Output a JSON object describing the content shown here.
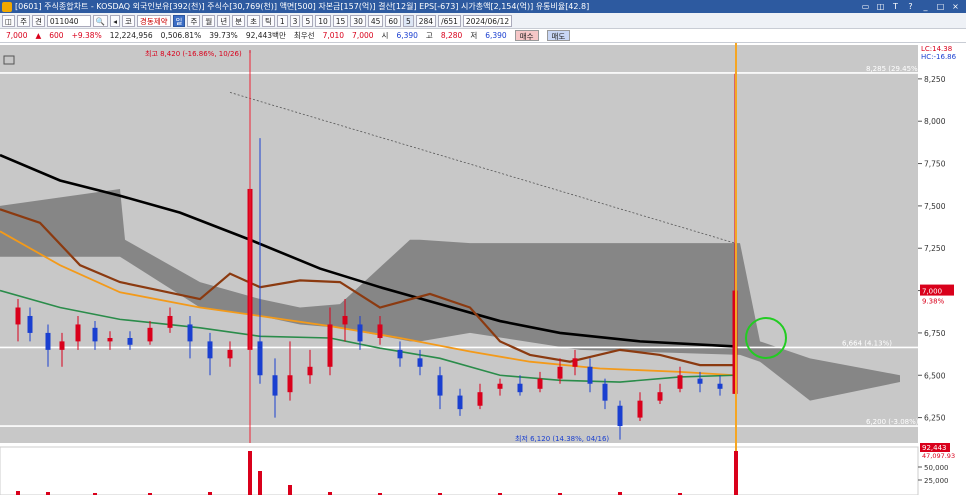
{
  "window": {
    "title": "[0601] 주식종합차트 - KOSDAQ 외국인보유[392(천)] 주식수[30,769(천)] 액면[500] 자본금[157(억)] 결산[12월] EPS[-673] 시가총액[2,154(억)] 유통비율[42.8]",
    "buttons": [
      "▭",
      "◫",
      "T",
      "?",
      "_",
      "□",
      "×"
    ]
  },
  "toolbar": {
    "items_left": [
      "◫",
      "주",
      "견",
      "조"
    ],
    "stock_code": "011040",
    "search_icon": "🔍",
    "arrow": "◂",
    "prefix": "코",
    "stock_name": "경동제약",
    "period_buttons": [
      "일",
      "주",
      "월",
      "년",
      "분",
      "초",
      "틱"
    ],
    "period_selected": "일",
    "interval_buttons": [
      "1",
      "3",
      "5",
      "10",
      "15",
      "30",
      "45",
      "60",
      "5"
    ],
    "count": "284",
    "total": "/651",
    "date": "2024/06/12"
  },
  "pricebar": {
    "price": "7,000",
    "arrow": "▲",
    "change": "600",
    "change_pct": "+9.38%",
    "volume": "12,224,956",
    "vol_pct": "0,506.81%",
    "turnover": "39.73%",
    "trade_amount": "92,443백만",
    "label_best": "최우선",
    "best": "7,010",
    "best2": "7,000",
    "open_label": "시",
    "open": "6,390",
    "high_label": "고",
    "high": "8,280",
    "low_label": "저",
    "low": "6,390",
    "buy_label": "매수",
    "sell_label": "매도"
  },
  "colors": {
    "bg": "#c8c8c8",
    "up": "#d9001b",
    "down": "#1a3fd0",
    "ichimoku": "#7a7a7a",
    "ma_long": "#000000",
    "ma_brown": "#8b3a10",
    "ma_orange": "#f39a1a",
    "ma_green": "#2a8c4a",
    "current_line": "#f5a623",
    "circle": "#22cc22"
  },
  "annotations": {
    "high": "최고 8,420 (-16.86%, 10/26)",
    "low": "최저 6,120 (14.38%, 04/16)",
    "level_top": "8,285 (29.45%)",
    "level_mid": "6,664 (4.13%)",
    "level_bot": "6,200 (-3.08%)",
    "lc": "LC:14.38",
    "hc": "HC:-16.86",
    "price_tag": "7,000",
    "price_tag_pct": "9.38%",
    "vol_tag": "92,443",
    "vol_tag2": "47,097.93",
    "mid_label": "6,664 (4.13%)"
  },
  "chart_data": {
    "type": "candlestick",
    "y_ticks": [
      "8,250",
      "8,000",
      "7,750",
      "7,500",
      "7,250",
      "7,000",
      "6,750",
      "6,500",
      "6,250"
    ],
    "y_range": [
      6100,
      8450
    ],
    "volume_ticks": [
      "50,000",
      "25,000"
    ],
    "horizontal_levels": [
      8285,
      6664,
      6200
    ]
  }
}
